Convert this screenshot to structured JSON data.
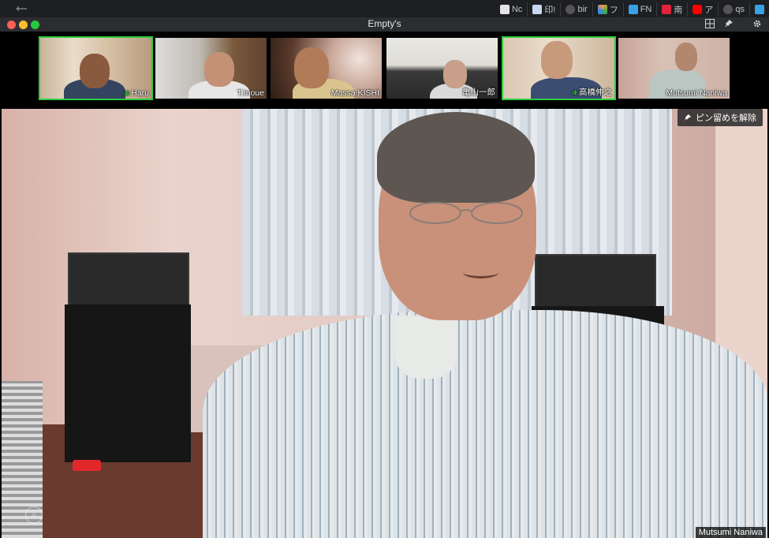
{
  "os_tabs": [
    {
      "label": "Nc",
      "color": "#e5e5e5"
    },
    {
      "label": "印!",
      "color": "#c9d6f0"
    },
    {
      "label": "bir",
      "color": "#555"
    },
    {
      "label": "フ",
      "color": "#e94"
    },
    {
      "label": "FN",
      "color": "#3aa0e6"
    },
    {
      "label": "南",
      "color": "#e0243a"
    },
    {
      "label": "ア",
      "color": "#ff0000"
    },
    {
      "label": "qs",
      "color": "#555"
    },
    {
      "label": "",
      "color": "#3aa0e6"
    }
  ],
  "window": {
    "title": "Empty's",
    "icons": [
      "gallery-view-icon",
      "pin-icon",
      "settings-icon"
    ]
  },
  "participants": [
    {
      "name": "Haru",
      "active": true,
      "speaking": true
    },
    {
      "name": "T.Inoue",
      "active": false,
      "speaking": false
    },
    {
      "name": "Massa KISHI",
      "active": false,
      "speaking": false
    },
    {
      "name": "亀山一郎",
      "active": false,
      "speaking": false
    },
    {
      "name": "高橋伸之",
      "active": true,
      "speaking": true
    },
    {
      "name": "Mutsumi Naniwa",
      "active": false,
      "speaking": false
    }
  ],
  "main_video": {
    "unpin_label": "ピン留めを解除",
    "speaker_name": "Mutsumi Naniwa"
  }
}
